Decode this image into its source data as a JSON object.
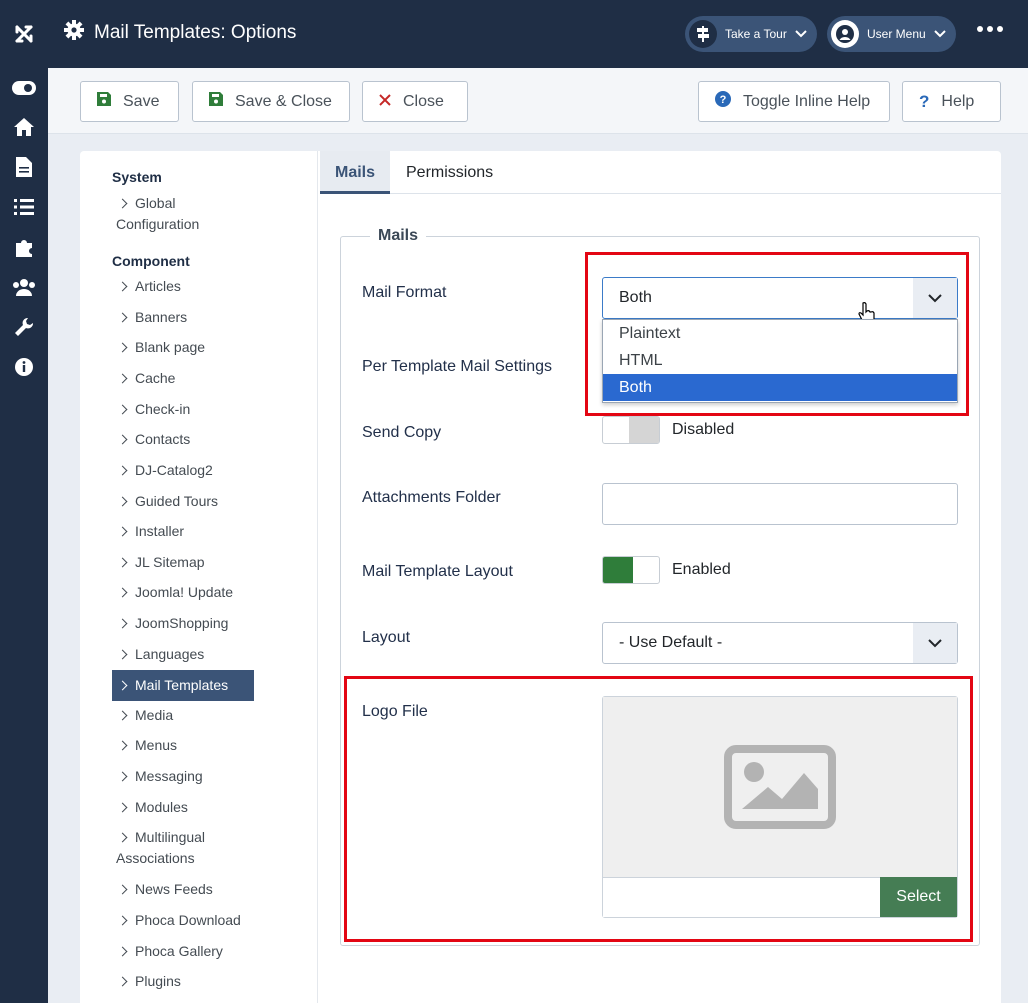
{
  "header": {
    "title": "Mail Templates: Options",
    "tour_label": "Take a Tour",
    "user_menu_label": "User Menu"
  },
  "toolbar": {
    "save_label": "Save",
    "save_close_label": "Save & Close",
    "close_label": "Close",
    "inline_help_label": "Toggle Inline Help",
    "help_label": "Help"
  },
  "nav": {
    "system_header": "System",
    "global_config_line1": "Global",
    "global_config_line2": "Configuration",
    "component_header": "Component",
    "items": [
      "Articles",
      "Banners",
      "Blank page",
      "Cache",
      "Check-in",
      "Contacts",
      "DJ-Catalog2",
      "Guided Tours",
      "Installer",
      "JL Sitemap",
      "Joomla! Update",
      "JoomShopping",
      "Languages",
      "Mail Templates",
      "Media",
      "Menus",
      "Messaging",
      "Modules",
      "Multilingual",
      "News Feeds",
      "Phoca Download",
      "Phoca Gallery",
      "Plugins"
    ],
    "multilingual_line2": "Associations",
    "active_item": "Mail Templates"
  },
  "tabs": [
    "Mails",
    "Permissions"
  ],
  "form": {
    "legend": "Mails",
    "mail_format_label": "Mail Format",
    "mail_format_value": "Both",
    "mail_format_options": [
      "Plaintext",
      "HTML",
      "Both"
    ],
    "per_template_label": "Per Template Mail Settings",
    "send_copy_label": "Send Copy",
    "send_copy_state": "Disabled",
    "attachments_label": "Attachments Folder",
    "attachments_value": "",
    "layout_toggle_label": "Mail Template Layout",
    "layout_toggle_state": "Enabled",
    "layout_label": "Layout",
    "layout_value": "- Use Default -",
    "logo_label": "Logo File",
    "logo_select_label": "Select"
  },
  "colors": {
    "sidebar_bg": "#1f2e45",
    "accent": "#3b5477",
    "toggle_on": "#2f7d3a",
    "select_button": "#457d54",
    "highlight_box": "#e30613",
    "option_selected": "#2a69d0"
  }
}
